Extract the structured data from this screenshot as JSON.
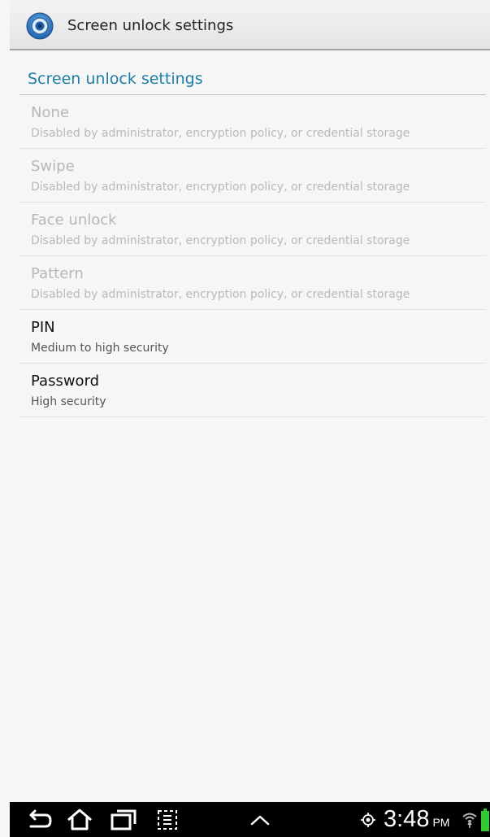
{
  "action_bar": {
    "title": "Screen unlock settings",
    "icon": "settings-gear-icon"
  },
  "category": {
    "title": "Screen unlock settings"
  },
  "preferences": [
    {
      "title": "None",
      "summary": "Disabled by administrator, encryption policy, or credential storage",
      "enabled": false
    },
    {
      "title": "Swipe",
      "summary": "Disabled by administrator, encryption policy, or credential storage",
      "enabled": false
    },
    {
      "title": "Face unlock",
      "summary": "Disabled by administrator, encryption policy, or credential storage",
      "enabled": false
    },
    {
      "title": "Pattern",
      "summary": "Disabled by administrator, encryption policy, or credential storage",
      "enabled": false
    },
    {
      "title": "PIN",
      "summary": "Medium to high security",
      "enabled": true
    },
    {
      "title": "Password",
      "summary": "High security",
      "enabled": true
    }
  ],
  "system_bar": {
    "nav_icons": [
      "back-icon",
      "home-icon",
      "recent-apps-icon",
      "screenshot-icon",
      "chevron-up-icon"
    ],
    "time": "3:48",
    "ampm": "PM",
    "status_icons": [
      "gps-icon",
      "wifi-icon",
      "battery-icon"
    ],
    "battery_color": "#34c734"
  },
  "colors": {
    "accent": "#1c7da6",
    "disabled_text": "#b7b7b7"
  }
}
